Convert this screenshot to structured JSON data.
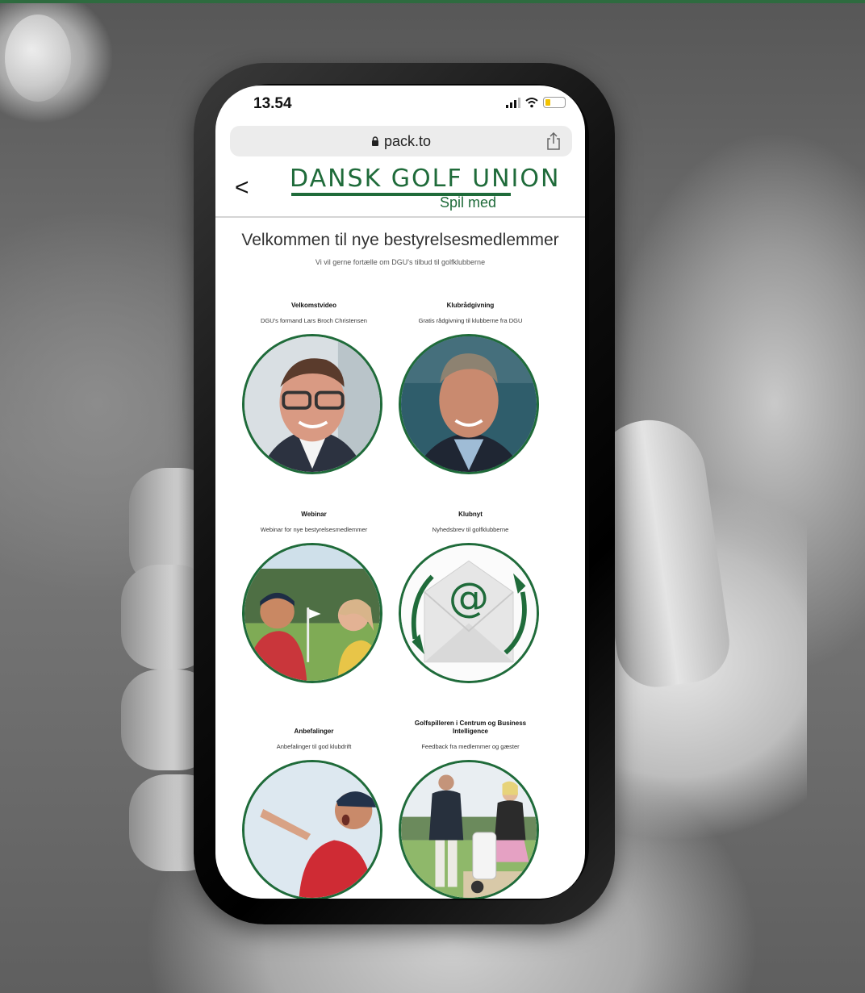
{
  "status_bar": {
    "time": "13.54"
  },
  "browser": {
    "url": "pack.to",
    "icons": [
      "lock-icon",
      "share-icon"
    ]
  },
  "header": {
    "back_symbol": "<",
    "logo_text": "DANSK GOLF UNION",
    "logo_tagline": "Spil med"
  },
  "page": {
    "title": "Velkommen til nye bestyrelsesmedlemmer",
    "subtitle": "Vi vil gerne fortælle om DGU's tilbud til golfklubberne"
  },
  "cards": [
    {
      "title": "Velkomstvideo",
      "subtitle": "DGU's formand Lars Broch Christensen"
    },
    {
      "title": "Klubrådgivning",
      "subtitle": "Gratis rådgivning til klubberne fra DGU"
    },
    {
      "title": "Webinar",
      "subtitle": "Webinar for nye bestyrelsesmedlemmer"
    },
    {
      "title": "Klubnyt",
      "subtitle": "Nyhedsbrev til golfklubberne"
    },
    {
      "title": "Anbefalinger",
      "subtitle": "Anbefalinger til god klubdrift"
    },
    {
      "title": "Golfspilleren i Centrum og Business Intelligence",
      "subtitle": "Feedback fra medlemmer og gæster"
    }
  ],
  "colors": {
    "brand_green": "#1f6b3a",
    "battery": "#f2c200"
  }
}
